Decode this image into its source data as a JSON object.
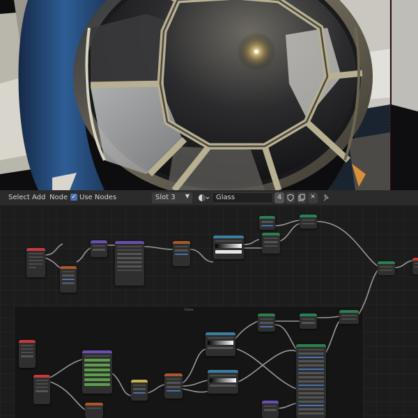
{
  "header": {
    "menus": [
      "Select",
      "Add",
      "Node"
    ],
    "use_nodes_label": "Use Nodes",
    "use_nodes_checked": true,
    "slot_label": "Slot 3",
    "material_name": "Glass",
    "user_count": "4"
  },
  "frame_label": "Frame",
  "colors": {
    "header_bg": "#2b2b2b",
    "editor_bg": "#1c1c1c",
    "accent_blue": "#4772b3",
    "node_header_red": "#c83a3a",
    "node_header_orange": "#a8582a",
    "node_header_purple": "#6a4fb0",
    "node_header_teal": "#3b7fa0",
    "node_header_green": "#2a8050",
    "node_header_yellow": "#c8b048"
  },
  "icons": {
    "material_browse": "sphere-material-icon",
    "fake_user": "shield-icon",
    "duplicate": "duplicate-icon",
    "unlink": "close-icon",
    "pin": "pin-icon",
    "use_nodes": "checkbox-icon",
    "dropdown": "chevron-down-icon"
  }
}
